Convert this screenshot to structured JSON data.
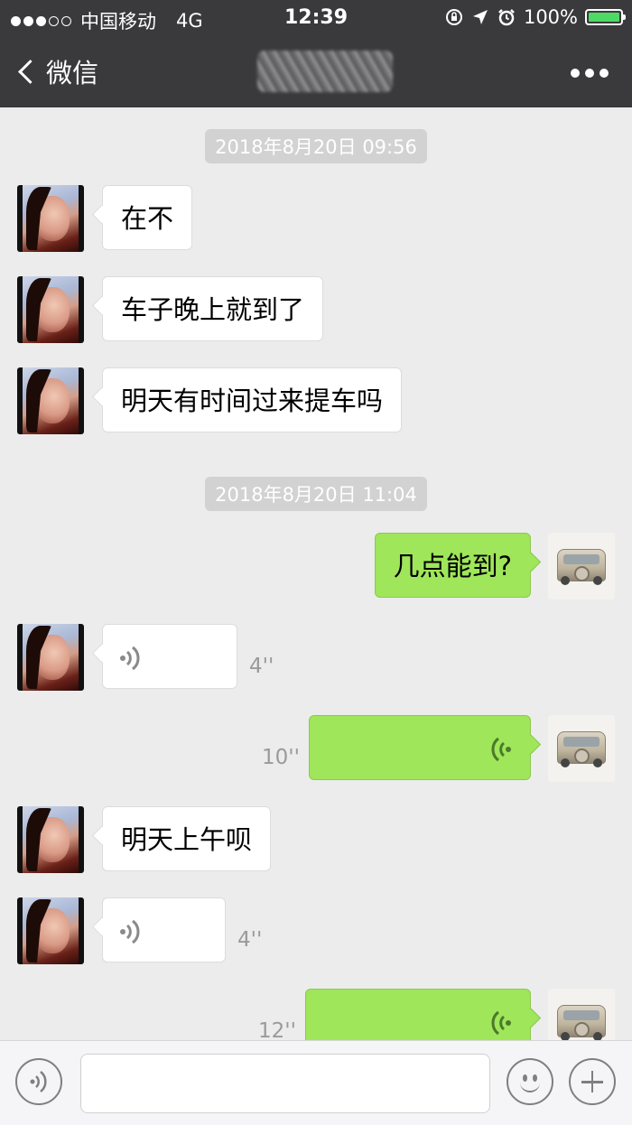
{
  "status_bar": {
    "carrier": "中国移动",
    "network": "4G",
    "time": "12:39",
    "battery": "100%"
  },
  "nav": {
    "back_label": "微信",
    "title_blurred": true
  },
  "messages": [
    {
      "type": "timestamp",
      "text": "2018年8月20日 09:56"
    },
    {
      "type": "text",
      "side": "left",
      "text": "在不"
    },
    {
      "type": "text",
      "side": "left",
      "text": "车子晚上就到了"
    },
    {
      "type": "text",
      "side": "left",
      "text": "明天有时间过来提车吗"
    },
    {
      "type": "timestamp",
      "text": "2018年8月20日 11:04"
    },
    {
      "type": "text",
      "side": "right",
      "text": "几点能到?"
    },
    {
      "type": "voice",
      "side": "left",
      "duration": "4''"
    },
    {
      "type": "voice",
      "side": "right",
      "duration": "10''"
    },
    {
      "type": "text",
      "side": "left",
      "text": "明天上午呗"
    },
    {
      "type": "voice",
      "side": "left",
      "duration": "4''"
    },
    {
      "type": "voice",
      "side": "right",
      "duration": "12''"
    }
  ],
  "colors": {
    "outgoing_bubble": "#9fe65a",
    "incoming_bubble": "#ffffff",
    "header": "#3a3a3c",
    "background": "#ececec"
  },
  "icons": {
    "voice_toggle": "voice-icon",
    "emoji": "emoji-icon",
    "more": "plus-icon"
  }
}
